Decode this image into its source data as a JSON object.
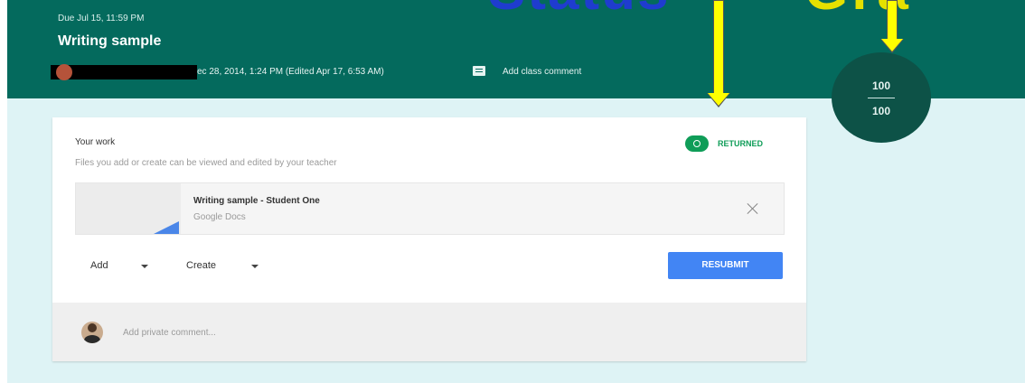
{
  "header": {
    "due": "Due Jul 15, 11:59 PM",
    "title": "Writing sample",
    "meta": "ec 28, 2014, 1:24 PM (Edited Apr 17, 6:53 AM)",
    "add_class_comment": "Add class comment"
  },
  "annotations": {
    "big_text": "Status",
    "big_text_2": "Gra",
    "arrow_color": "#ffff00"
  },
  "grade": {
    "score": "100",
    "total": "100"
  },
  "work": {
    "heading": "Your work",
    "subtext": "Files you add or create can be viewed and edited by your teacher",
    "status_label": "RETURNED",
    "attachment": {
      "title": "Writing sample - Student One",
      "type": "Google Docs"
    },
    "add_label": "Add",
    "create_label": "Create",
    "resubmit_label": "RESUBMIT",
    "private_comment_placeholder": "Add private comment..."
  },
  "colors": {
    "header_bg": "#046a5d",
    "page_bg": "#def3f5",
    "accent_blue": "#4285f4",
    "status_green": "#0f9d58"
  },
  "icons": [
    "comment-icon",
    "returned-eye-icon",
    "close-icon",
    "chevron-down-icon",
    "avatar"
  ]
}
